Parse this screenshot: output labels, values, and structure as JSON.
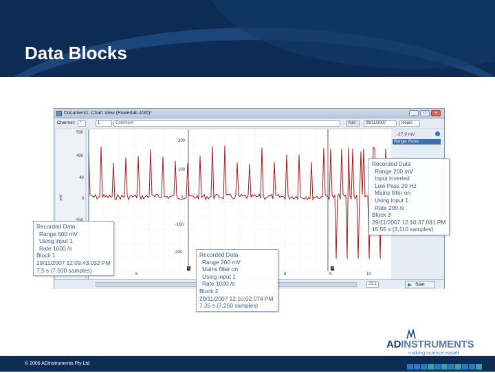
{
  "slide": {
    "title": "Data Blocks"
  },
  "window": {
    "title": "Document1: Chart View (Powerlab 4/30)*",
    "buttons": [
      "_",
      "□",
      "×"
    ]
  },
  "toolbar": {
    "channel_label": "Channel:",
    "channel_value": "1",
    "comment_placeholder": "Comment",
    "add_label": "Add",
    "date_value": "29/11/2007",
    "time_unit": "Hours"
  },
  "plot": {
    "left_ticks": [
      "500",
      "400",
      "40",
      "0",
      "500"
    ],
    "units": "mV",
    "y_ticks": [
      "200",
      "100",
      "0",
      "-100",
      "-200"
    ],
    "x_ticks": [
      "5",
      "6",
      "5",
      "10"
    ],
    "readout": "-27.9 mV",
    "range_dropdown": "Range: Pulse",
    "start_button": "Start",
    "zoom_value": "20:1",
    "block_markers": [
      "1",
      "2",
      "3"
    ]
  },
  "callouts": {
    "block1": [
      "Recorded Data",
      "Range 500 mV",
      "Using input 1",
      "Rate 1000 /s",
      "Block 1",
      "29/11/2007 12:09:43.032 PM",
      "7.5 s (7,500 samples)"
    ],
    "block2": [
      "Recorded Data",
      "Range 200 mV",
      "Mains filter on",
      "Using input 1",
      "Rate 1000 /s",
      "Block 2",
      "29/11/2007 12:10:02.074 PM",
      "7.25 s (7,250 samples)"
    ],
    "block3": [
      "Recorded Data",
      "Range 200 mV",
      "Input inverted",
      "Low Pass 20 Hz",
      "Mains filter on",
      "Using input 1",
      "Rate 200 /s",
      "Block 3",
      "29/11/2007 12:10:37.081 PM",
      "15.55 s (3,110 samples)"
    ]
  },
  "logo": {
    "name_bold": "AD",
    "name_rest": "INSTRUMENTS",
    "tagline": "making science easier"
  },
  "footer": {
    "copyright": "© 2006 ADInstruments Pty Ltd"
  },
  "colors": {
    "header": "#0d2c55",
    "trace": "#a8171b",
    "callout_text": "#3d5a7d",
    "footer_square_blue": "#2f79c2",
    "footer_square_teal": "#3aa0a0"
  }
}
